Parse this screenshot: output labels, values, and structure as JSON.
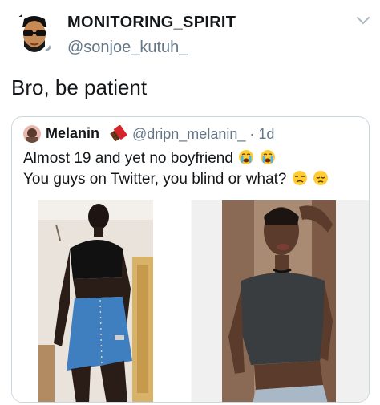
{
  "tweet": {
    "display_name": "MONITORING_SPIRIT",
    "handle": "@sonjoe_kutuh_",
    "text": "Bro, be patient"
  },
  "quoted_tweet": {
    "display_name": "Melanin",
    "handle_and_time": "@dripn_melanin_ · 1d",
    "line1": "Almost 19 and yet no boyfriend",
    "line2": "You guys on Twitter, you blind or what?",
    "line1_emojis": [
      "crying-face",
      "crying-face"
    ],
    "line2_emojis": [
      "unamused-face",
      "disappointed-face"
    ],
    "name_emoji": "chocolate-bar"
  },
  "icons": {
    "avatar": "sunglasses-avatar",
    "menu": "chevron-down-icon"
  },
  "colors": {
    "text": "#14171a",
    "secondary": "#657786",
    "border": "#ccd6dd"
  }
}
